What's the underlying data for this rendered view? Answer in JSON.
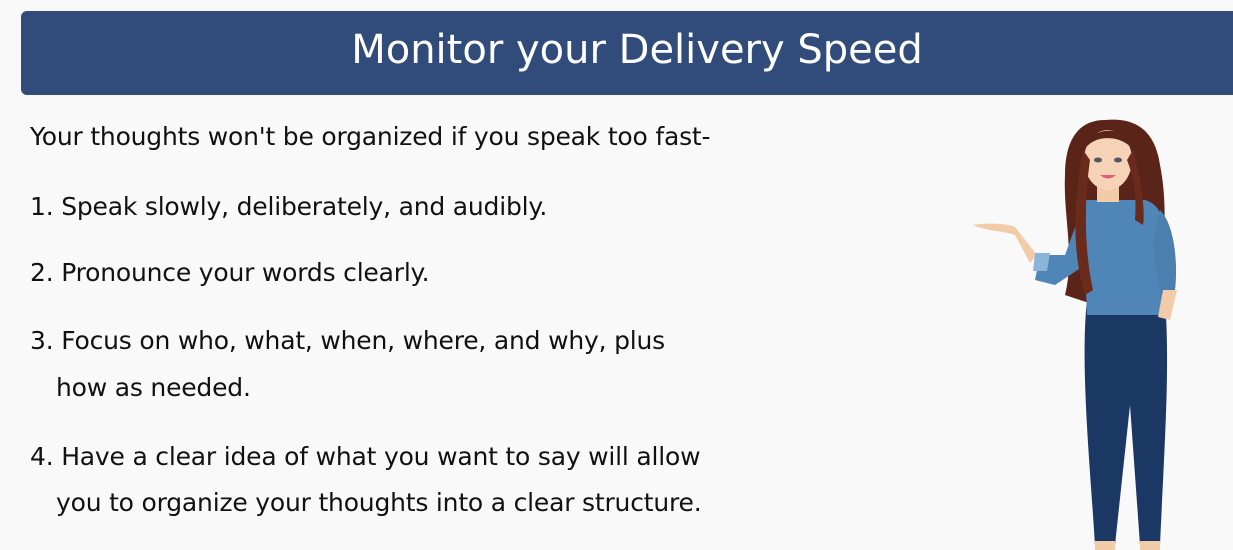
{
  "slide": {
    "title": "Monitor your Delivery Speed",
    "intro": "Your thoughts won't be organized if you speak too fast-",
    "points": [
      {
        "line1": "1. Speak slowly, deliberately, and audibly."
      },
      {
        "line1": "2. Pronounce your words clearly."
      },
      {
        "line1": "3. Focus on who, what, when, where, and why, plus",
        "line2": "how as needed."
      },
      {
        "line1": "4. Have a clear idea of what you want to say will allow",
        "line2": "you to organize your thoughts into a clear structure."
      }
    ],
    "colors": {
      "header": "#314b7b",
      "background": "#f9f9f9"
    }
  }
}
